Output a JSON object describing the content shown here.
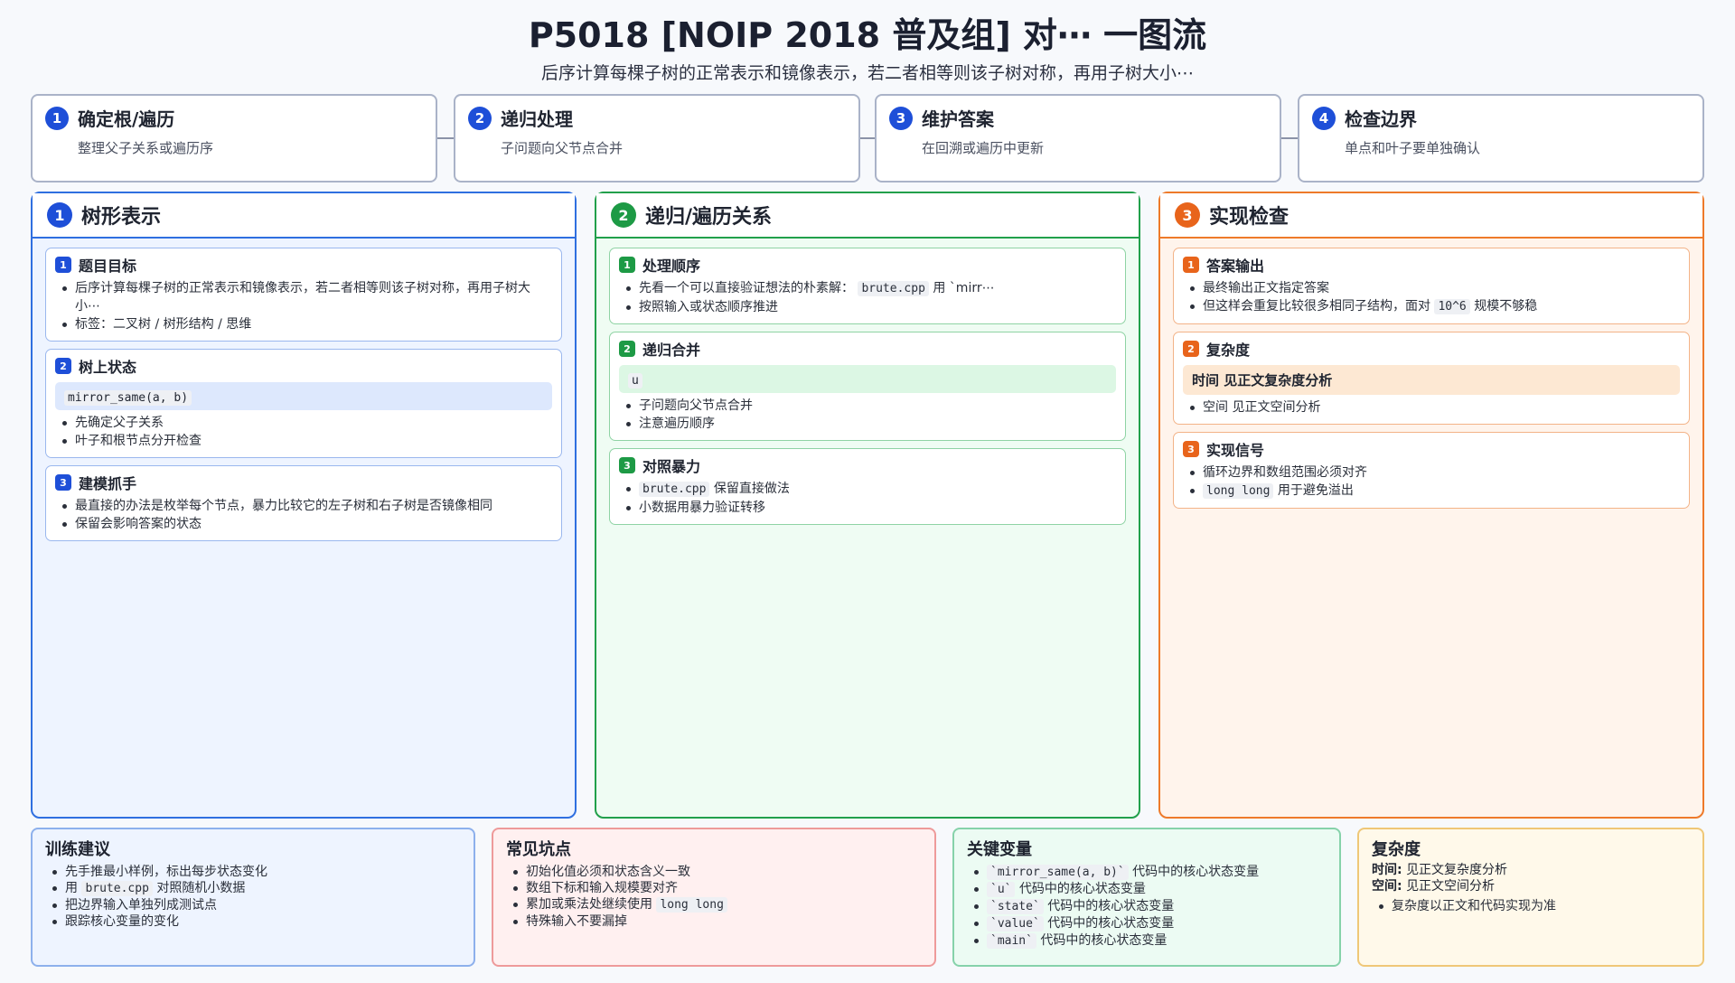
{
  "header": {
    "title": "P5018 [NOIP 2018 普及组] 对⋯ 一图流",
    "subtitle": "后序计算每棵子树的正常表示和镜像表示，若二者相等则该子树对称，再用子树大小⋯"
  },
  "steps": [
    {
      "num": "1",
      "title": "确定根/遍历",
      "desc": "整理父子关系或遍历序"
    },
    {
      "num": "2",
      "title": "递归处理",
      "desc": "子问题向父节点合并"
    },
    {
      "num": "3",
      "title": "维护答案",
      "desc": "在回溯或遍历中更新"
    },
    {
      "num": "4",
      "title": "检查边界",
      "desc": "单点和叶子要单独确认"
    }
  ],
  "columns": {
    "tree": {
      "num": "1",
      "title": "树形表示",
      "cards": [
        {
          "num": "1",
          "title": "题目目标",
          "bullets": [
            "后序计算每棵子树的正常表示和镜像表示，若二者相等则该子树对称，再用子树大小⋯",
            "标签：二叉树 / 树形结构 / 思维"
          ]
        },
        {
          "num": "2",
          "title": "树上状态",
          "highlight": "mirror_same(a, b)",
          "bullets": [
            "先确定父子关系",
            "叶子和根节点分开检查"
          ]
        },
        {
          "num": "3",
          "title": "建模抓手",
          "bullets": [
            "最直接的办法是枚举每个节点，暴力比较它的左子树和右子树是否镜像相同",
            "保留会影响答案的状态"
          ]
        }
      ]
    },
    "recur": {
      "num": "2",
      "title": "递归/遍历关系",
      "cards": [
        {
          "num": "1",
          "title": "处理顺序",
          "b1_pre": "先看一个可以直接验证想法的朴素解：",
          "b1_code": "brute.cpp",
          "b1_post": "用 `mirr⋯",
          "b2": "按照输入或状态顺序推进"
        },
        {
          "num": "2",
          "title": "递归合并",
          "highlight": "u",
          "bullets": [
            "子问题向父节点合并",
            "注意遍历顺序"
          ]
        },
        {
          "num": "3",
          "title": "对照暴力",
          "b1_code": "brute.cpp",
          "b1_post": "保留直接做法",
          "b2": "小数据用暴力验证转移"
        }
      ]
    },
    "impl": {
      "num": "3",
      "title": "实现检查",
      "cards": [
        {
          "num": "1",
          "title": "答案输出",
          "b1": "最终输出正文指定答案",
          "b2_pre": "但这样会重复比较很多相同子结构，面对",
          "b2_code": "10^6",
          "b2_post": "规模不够稳"
        },
        {
          "num": "2",
          "title": "复杂度",
          "highlight": "时间 见正文复杂度分析",
          "bullets": [
            "空间 见正文空间分析"
          ]
        },
        {
          "num": "3",
          "title": "实现信号",
          "b1": "循环边界和数组范围必须对齐",
          "b2_code": "long long",
          "b2_post": "用于避免溢出"
        }
      ]
    }
  },
  "bottom": {
    "training": {
      "title": "训练建议",
      "b1": "先手推最小样例，标出每步状态变化",
      "b2_pre": "用",
      "b2_code": "brute.cpp",
      "b2_post": "对照随机小数据",
      "b3": "把边界输入单独列成测试点",
      "b4": "跟踪核心变量的变化"
    },
    "pitfalls": {
      "title": "常见坑点",
      "b1": "初始化值必须和状态含义一致",
      "b2": "数组下标和输入规模要对齐",
      "b3_pre": "累加或乘法处继续使用",
      "b3_code": "long long",
      "b4": "特殊输入不要漏掉"
    },
    "variables": {
      "title": "关键变量",
      "items": [
        {
          "code": "`mirror_same(a, b)`",
          "text": "代码中的核心状态变量"
        },
        {
          "code": "`u`",
          "text": "代码中的核心状态变量"
        },
        {
          "code": "`state`",
          "text": "代码中的核心状态变量"
        },
        {
          "code": "`value`",
          "text": "代码中的核心状态变量"
        },
        {
          "code": "`main`",
          "text": "代码中的核心状态变量"
        }
      ]
    },
    "complexity": {
      "title": "复杂度",
      "time_label": "时间:",
      "time_value": "见正文复杂度分析",
      "space_label": "空间:",
      "space_value": "见正文空间分析",
      "note": "复杂度以正文和代码实现为准"
    }
  }
}
